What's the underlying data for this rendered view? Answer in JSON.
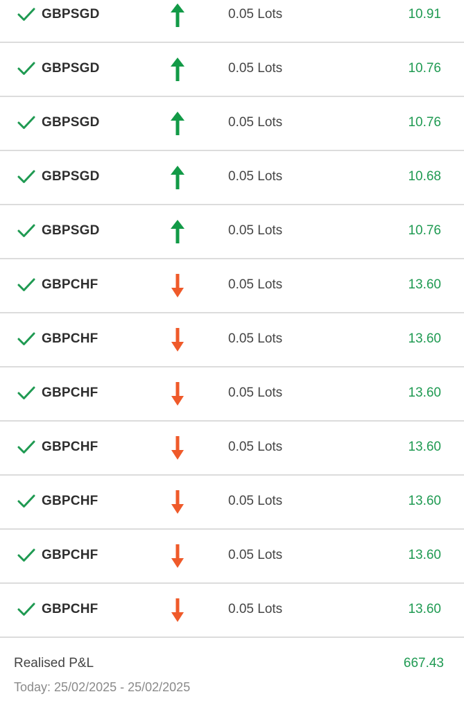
{
  "colors": {
    "profit_green": "#1f9a52",
    "buy_arrow_green": "#129a47",
    "sell_arrow_orange": "#ef5a2a",
    "check_green": "#1f9a52"
  },
  "trades": [
    {
      "symbol": "GBPSGD",
      "direction": "up",
      "direction_icon": "arrow-up-icon",
      "lots": "0.05 Lots",
      "profit": "10.91"
    },
    {
      "symbol": "GBPSGD",
      "direction": "up",
      "direction_icon": "arrow-up-icon",
      "lots": "0.05 Lots",
      "profit": "10.76"
    },
    {
      "symbol": "GBPSGD",
      "direction": "up",
      "direction_icon": "arrow-up-icon",
      "lots": "0.05 Lots",
      "profit": "10.76"
    },
    {
      "symbol": "GBPSGD",
      "direction": "up",
      "direction_icon": "arrow-up-icon",
      "lots": "0.05 Lots",
      "profit": "10.68"
    },
    {
      "symbol": "GBPSGD",
      "direction": "up",
      "direction_icon": "arrow-up-icon",
      "lots": "0.05 Lots",
      "profit": "10.76"
    },
    {
      "symbol": "GBPCHF",
      "direction": "down",
      "direction_icon": "arrow-down-icon",
      "lots": "0.05 Lots",
      "profit": "13.60"
    },
    {
      "symbol": "GBPCHF",
      "direction": "down",
      "direction_icon": "arrow-down-icon",
      "lots": "0.05 Lots",
      "profit": "13.60"
    },
    {
      "symbol": "GBPCHF",
      "direction": "down",
      "direction_icon": "arrow-down-icon",
      "lots": "0.05 Lots",
      "profit": "13.60"
    },
    {
      "symbol": "GBPCHF",
      "direction": "down",
      "direction_icon": "arrow-down-icon",
      "lots": "0.05 Lots",
      "profit": "13.60"
    },
    {
      "symbol": "GBPCHF",
      "direction": "down",
      "direction_icon": "arrow-down-icon",
      "lots": "0.05 Lots",
      "profit": "13.60"
    },
    {
      "symbol": "GBPCHF",
      "direction": "down",
      "direction_icon": "arrow-down-icon",
      "lots": "0.05 Lots",
      "profit": "13.60"
    },
    {
      "symbol": "GBPCHF",
      "direction": "down",
      "direction_icon": "arrow-down-icon",
      "lots": "0.05 Lots",
      "profit": "13.60"
    }
  ],
  "summary": {
    "realised_label": "Realised P&L",
    "realised_value": "667.43",
    "date_range": "Today: 25/02/2025 - 25/02/2025"
  }
}
